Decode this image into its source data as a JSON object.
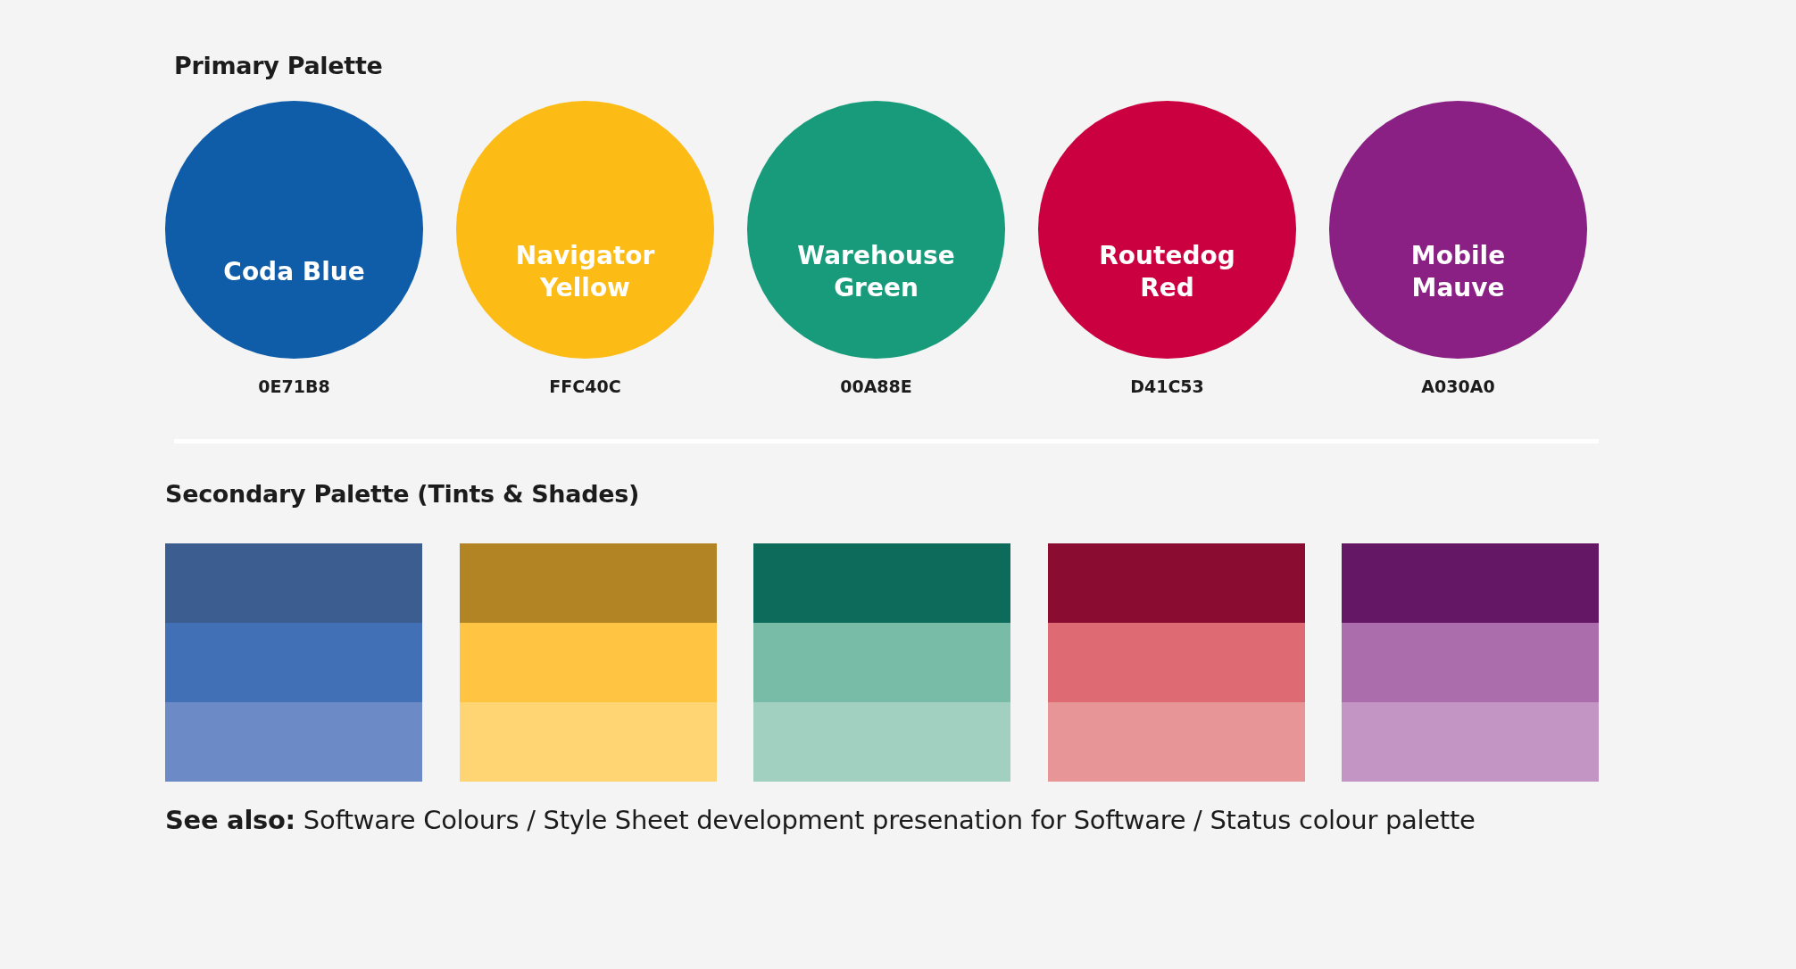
{
  "primary": {
    "title": "Primary Palette",
    "swatches": [
      {
        "name": "Coda Blue",
        "hex": "0E71B8",
        "color": "#0f5ca9"
      },
      {
        "name": "Navigator\nYellow",
        "hex": "FFC40C",
        "color": "#fdbb16"
      },
      {
        "name": "Warehouse\nGreen",
        "hex": "00A88E",
        "color": "#189b7a"
      },
      {
        "name": "Routedog\nRed",
        "hex": "D41C53",
        "color": "#cb0040"
      },
      {
        "name": "Mobile\nMauve",
        "hex": "A030A0",
        "color": "#8a1f84"
      }
    ]
  },
  "secondary": {
    "title": "Secondary Palette (Tints & Shades)",
    "groups": [
      {
        "shades": [
          {
            "color": "#3c5d90"
          },
          {
            "color": "#4170b6"
          },
          {
            "color": "#6b8ac6"
          }
        ]
      },
      {
        "shades": [
          {
            "color": "#b28424"
          },
          {
            "color": "#ffc542"
          },
          {
            "color": "#ffd574"
          }
        ]
      },
      {
        "shades": [
          {
            "color": "#0d6b5b"
          },
          {
            "color": "#78bba7"
          },
          {
            "color": "#a1cfc0"
          }
        ]
      },
      {
        "shades": [
          {
            "color": "#8a0c30"
          },
          {
            "color": "#de6b73"
          },
          {
            "color": "#e79597"
          }
        ]
      },
      {
        "shades": [
          {
            "color": "#641765"
          },
          {
            "color": "#ac6dac"
          },
          {
            "color": "#c295c5"
          }
        ]
      }
    ]
  },
  "see_also": "**See also:** Software Colours / Style Sheet development presenation for Software / Status colour palette"
}
